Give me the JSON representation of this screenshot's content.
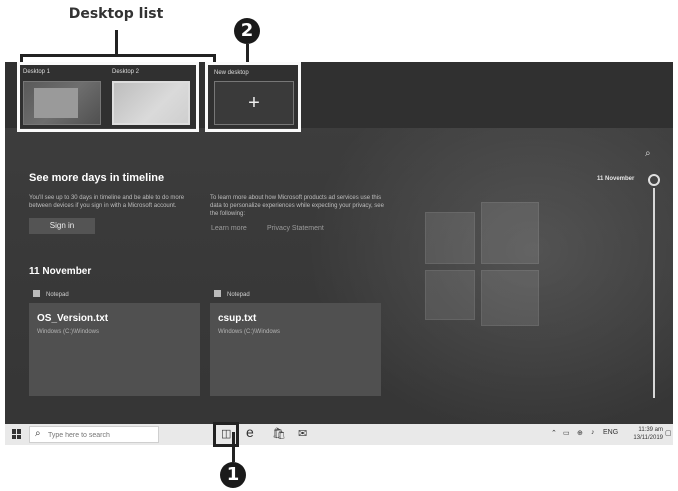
{
  "annotations": {
    "desktop_list_title": "Desktop list",
    "marker_2": "2",
    "marker_1": "1"
  },
  "desktops": {
    "items": [
      {
        "label": "Desktop 1"
      },
      {
        "label": "Desktop 2"
      }
    ],
    "new_desktop_label": "New desktop",
    "new_desktop_icon": "+"
  },
  "timeline_promo": {
    "heading": "See more days in timeline",
    "left_text": "You'll see up to 30 days in timeline and be able to do more between devices if you sign in with a Microsoft account.",
    "right_text": "To learn more about how Microsoft products ad services use this data to personalize experiences while expecting your privacy, see the following:",
    "signin_label": "Sign in",
    "learn_more": "Learn more",
    "privacy": "Privacy Statement"
  },
  "activity": {
    "date": "11 November",
    "cards": [
      {
        "app": "Notepad",
        "title": "OS_Version.txt",
        "path": "Windows (C:)\\Windows"
      },
      {
        "app": "Notepad",
        "title": "csup.txt",
        "path": "Windows (C:)\\Windows"
      }
    ]
  },
  "timeline_scroll": {
    "date": "11 November"
  },
  "taskbar": {
    "search_placeholder": "Type here to search",
    "language": "ENG",
    "time": "11:39 am",
    "date": "13/11/2019"
  },
  "colors": {
    "screen_bg": "#3a3a3a",
    "card_bg": "#505050",
    "taskbar_bg": "#e9e9e9",
    "callout": "#1a1a1a"
  }
}
